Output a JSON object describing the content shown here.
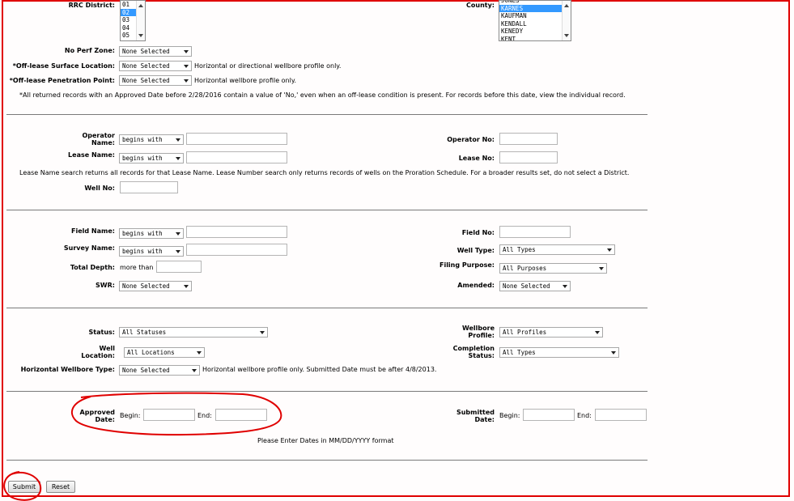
{
  "top": {
    "rrc_district_label": "RRC District:",
    "rrc_district_options": [
      "01",
      "02",
      "03",
      "04",
      "05"
    ],
    "rrc_district_selected": "02",
    "county_label": "County:",
    "county_options": [
      "JONES",
      "KARNES",
      "KAUFMAN",
      "KENDALL",
      "KENEDY",
      "KENT"
    ],
    "county_selected": "KARNES",
    "no_perf_zone_label": "No Perf Zone:",
    "no_perf_zone_value": "None Selected",
    "off_lease_surface_label": "*Off-lease Surface Location:",
    "off_lease_surface_value": "None Selected",
    "off_lease_surface_note": "Horizontal or directional wellbore profile only.",
    "off_lease_penetration_label": "*Off-lease Penetration Point:",
    "off_lease_penetration_value": "None Selected",
    "off_lease_penetration_note": "Horizontal wellbore profile only.",
    "footnote": "*All returned records with an Approved Date before 2/28/2016 contain a value of 'No,' even when an off-lease condition is present. For records before this date, view the individual record."
  },
  "operator": {
    "operator_name_label": "Operator Name:",
    "operator_name_mode": "begins with",
    "operator_no_label": "Operator No:",
    "lease_name_label": "Lease Name:",
    "lease_name_mode": "begins with",
    "lease_no_label": "Lease No:",
    "lease_note": "Lease Name search returns all records for that Lease Name. Lease Number search only returns records of wells on the Proration Schedule. For a broader results set, do not select a District.",
    "well_no_label": "Well No:"
  },
  "field": {
    "field_name_label": "Field Name:",
    "field_name_mode": "begins with",
    "field_no_label": "Field No:",
    "survey_name_label": "Survey Name:",
    "survey_name_mode": "begins with",
    "well_type_label": "Well Type:",
    "well_type_value": "All Types",
    "total_depth_label": "Total Depth:",
    "total_depth_prefix": "more than",
    "filing_purpose_label": "Filing Purpose:",
    "filing_purpose_value": "All Purposes",
    "swr_label": "SWR:",
    "swr_value": "None Selected",
    "amended_label": "Amended:",
    "amended_value": "None Selected"
  },
  "status": {
    "status_label": "Status:",
    "status_value": "All Statuses",
    "wellbore_profile_label": "Wellbore Profile:",
    "wellbore_profile_value": "All Profiles",
    "well_location_label": "Well Location:",
    "well_location_value": "All Locations",
    "completion_status_label": "Completion Status:",
    "completion_status_value": "All Types",
    "horizontal_wellbore_label": "Horizontal Wellbore Type:",
    "horizontal_wellbore_value": "None Selected",
    "horizontal_wellbore_note": "Horizontal wellbore profile only. Submitted Date must be after 4/8/2013."
  },
  "dates": {
    "approved_date_label": "Approved Date:",
    "submitted_date_label": "Submitted Date:",
    "begin_label": "Begin:",
    "end_label": "End:",
    "format_note": "Please Enter Dates in MM/DD/YYYY format"
  },
  "buttons": {
    "submit": "Submit",
    "reset": "Reset"
  },
  "colors": {
    "annotation_red": "#e00000",
    "selection_blue": "#3399ff"
  }
}
